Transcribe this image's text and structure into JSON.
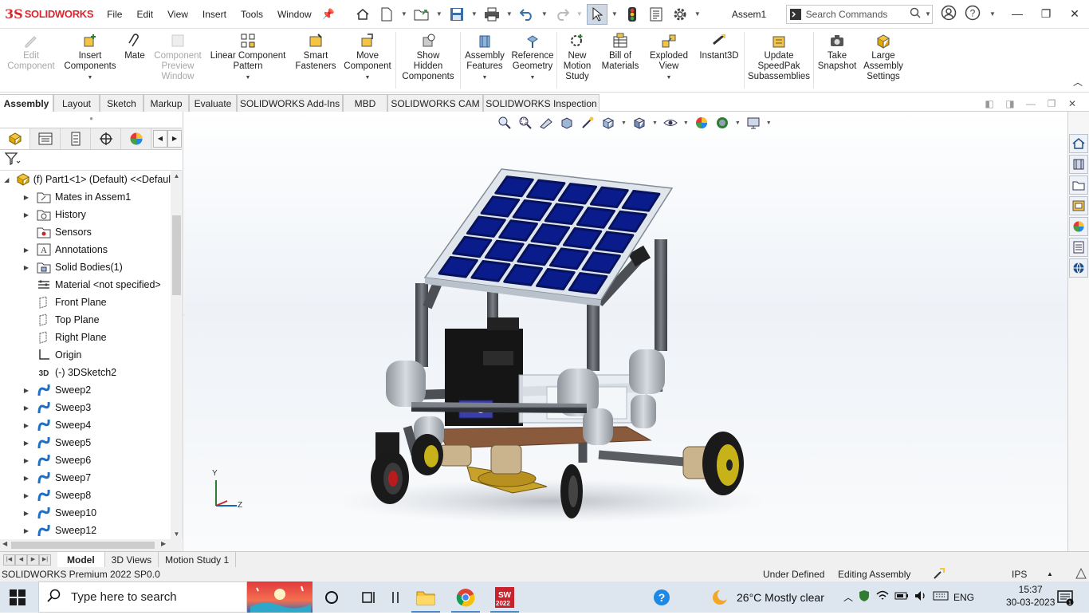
{
  "app": {
    "brand": "SOLIDWORKS",
    "menu": [
      "File",
      "Edit",
      "View",
      "Insert",
      "Tools",
      "Window"
    ],
    "document_title": "Assem1",
    "search_placeholder": "Search Commands"
  },
  "ribbon": {
    "buttons": [
      {
        "label_lines": [
          "Edit",
          "Component"
        ],
        "disabled": true,
        "icon": "edit-component-icon"
      },
      {
        "label_lines": [
          "Insert",
          "Components"
        ],
        "disabled": false,
        "icon": "insert-components-icon",
        "dropdown": true
      },
      {
        "label_lines": [
          "Mate"
        ],
        "disabled": false,
        "icon": "mate-icon"
      },
      {
        "label_lines": [
          "Component",
          "Preview",
          "Window"
        ],
        "disabled": true,
        "icon": "component-preview-icon"
      },
      {
        "label_lines": [
          "Linear Component",
          "Pattern"
        ],
        "disabled": false,
        "icon": "linear-pattern-icon",
        "dropdown": true
      },
      {
        "label_lines": [
          "Smart",
          "Fasteners"
        ],
        "disabled": false,
        "icon": "smart-fasteners-icon"
      },
      {
        "label_lines": [
          "Move",
          "Component"
        ],
        "disabled": false,
        "icon": "move-component-icon",
        "dropdown": true
      },
      {
        "label_lines": [
          "Show",
          "Hidden",
          "Components"
        ],
        "disabled": false,
        "icon": "show-hidden-icon"
      },
      {
        "label_lines": [
          "Assembly",
          "Features"
        ],
        "disabled": false,
        "icon": "assembly-features-icon",
        "dropdown": true
      },
      {
        "label_lines": [
          "Reference",
          "Geometry"
        ],
        "disabled": false,
        "icon": "reference-geometry-icon",
        "dropdown": true
      },
      {
        "label_lines": [
          "New",
          "Motion",
          "Study"
        ],
        "disabled": false,
        "icon": "motion-study-icon"
      },
      {
        "label_lines": [
          "Bill of",
          "Materials"
        ],
        "disabled": false,
        "icon": "bom-icon"
      },
      {
        "label_lines": [
          "Exploded",
          "View"
        ],
        "disabled": false,
        "icon": "exploded-view-icon",
        "dropdown": true
      },
      {
        "label_lines": [
          "Instant3D"
        ],
        "disabled": false,
        "icon": "instant3d-icon"
      },
      {
        "label_lines": [
          "Update",
          "SpeedPak",
          "Subassemblies"
        ],
        "disabled": false,
        "icon": "speedpak-icon"
      },
      {
        "label_lines": [
          "Take",
          "Snapshot"
        ],
        "disabled": false,
        "icon": "snapshot-icon"
      },
      {
        "label_lines": [
          "Large",
          "Assembly",
          "Settings"
        ],
        "disabled": false,
        "icon": "large-assembly-icon"
      }
    ]
  },
  "command_tabs": [
    "Assembly",
    "Layout",
    "Sketch",
    "Markup",
    "Evaluate",
    "SOLIDWORKS Add-Ins",
    "MBD",
    "SOLIDWORKS CAM",
    "SOLIDWORKS Inspection"
  ],
  "active_command_tab": "Assembly",
  "tree": {
    "root": "(f) Part1<1> (Default) <<Defaul",
    "items": [
      {
        "label": "Mates in Assem1",
        "expandable": true,
        "icon": "mates-folder-icon"
      },
      {
        "label": "History",
        "expandable": true,
        "icon": "history-folder-icon"
      },
      {
        "label": "Sensors",
        "expandable": false,
        "icon": "sensors-icon"
      },
      {
        "label": "Annotations",
        "expandable": true,
        "icon": "annotations-icon"
      },
      {
        "label": "Solid Bodies(1)",
        "expandable": true,
        "icon": "solid-bodies-icon"
      },
      {
        "label": "Material <not specified>",
        "expandable": false,
        "icon": "material-icon"
      },
      {
        "label": "Front Plane",
        "expandable": false,
        "icon": "plane-icon"
      },
      {
        "label": "Top Plane",
        "expandable": false,
        "icon": "plane-icon"
      },
      {
        "label": "Right Plane",
        "expandable": false,
        "icon": "plane-icon"
      },
      {
        "label": "Origin",
        "expandable": false,
        "icon": "origin-icon"
      },
      {
        "label": "(-) 3DSketch2",
        "expandable": false,
        "icon": "3dsketch-icon"
      },
      {
        "label": "Sweep2",
        "expandable": true,
        "icon": "sweep-icon"
      },
      {
        "label": "Sweep3",
        "expandable": true,
        "icon": "sweep-icon"
      },
      {
        "label": "Sweep4",
        "expandable": true,
        "icon": "sweep-icon"
      },
      {
        "label": "Sweep5",
        "expandable": true,
        "icon": "sweep-icon"
      },
      {
        "label": "Sweep6",
        "expandable": true,
        "icon": "sweep-icon"
      },
      {
        "label": "Sweep7",
        "expandable": true,
        "icon": "sweep-icon"
      },
      {
        "label": "Sweep8",
        "expandable": true,
        "icon": "sweep-icon"
      },
      {
        "label": "Sweep10",
        "expandable": true,
        "icon": "sweep-icon"
      },
      {
        "label": "Sweep12",
        "expandable": true,
        "icon": "sweep-icon"
      }
    ]
  },
  "bottom_tabs": [
    "Model",
    "3D Views",
    "Motion Study 1"
  ],
  "active_bottom_tab": "Model",
  "status": {
    "product": "SOLIDWORKS Premium 2022 SP0.0",
    "definition": "Under Defined",
    "mode": "Editing Assembly",
    "units": "IPS"
  },
  "triad": {
    "y": "Y",
    "z": "Z"
  },
  "taskbar": {
    "search_placeholder": "Type here to search",
    "app_badge": "2022",
    "weather": "26°C  Mostly clear",
    "language": "ENG",
    "time": "15:37",
    "date": "30-03-2023"
  },
  "colors": {
    "brand_red": "#d9262c",
    "solar_cell": "#0a1c8c",
    "pipe_gray": "#5a5d62",
    "taskbar": "#dde6ef"
  }
}
